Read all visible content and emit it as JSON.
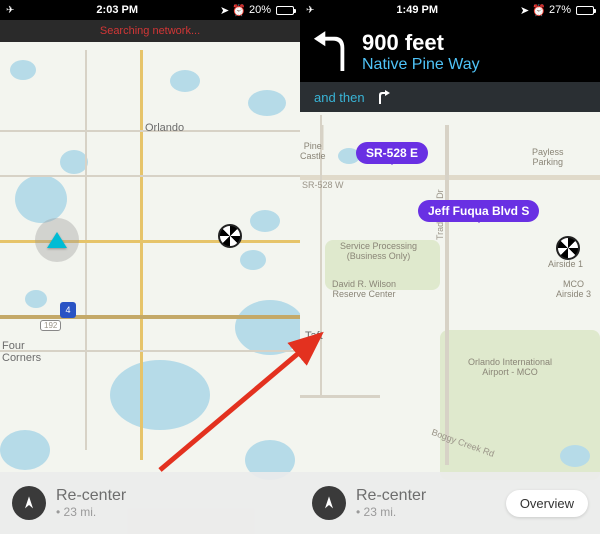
{
  "left": {
    "status": {
      "time": "2:03 PM",
      "battery_pct": "20%"
    },
    "network_banner": "Searching network...",
    "map": {
      "city_label": "Orlando",
      "corner_label": "Four\nCorners",
      "interstate_shield": "4",
      "route_number": "192"
    },
    "bottom": {
      "title": "Re-center",
      "sub": "• 23 mi."
    }
  },
  "right": {
    "status": {
      "time": "1:49 PM",
      "battery_pct": "27%"
    },
    "nav": {
      "distance": "900 feet",
      "street": "Native Pine Way",
      "and_then": "and then"
    },
    "map": {
      "pill_top": "SR-528 E",
      "pill_mid": "Jeff Fuqua Blvd S",
      "label_pine_castle": "Pine\nCastle",
      "label_taft": "Taft",
      "label_payless": "Payless\nParking",
      "label_svc": "Service Processing\n(Business Only)",
      "label_wilson": "David R. Wilson\nReserve Center",
      "label_airside": "Airside 1",
      "label_airside3": "MCO\nAirside 3",
      "label_airport": "Orlando International\nAirport - MCO",
      "road_528w": "SR-528 W",
      "road_tradeport": "Tradeport Dr",
      "road_boggy": "Boggy Creek Rd"
    },
    "bottom": {
      "title": "Re-center",
      "sub": "• 23 mi.",
      "overview": "Overview"
    }
  }
}
